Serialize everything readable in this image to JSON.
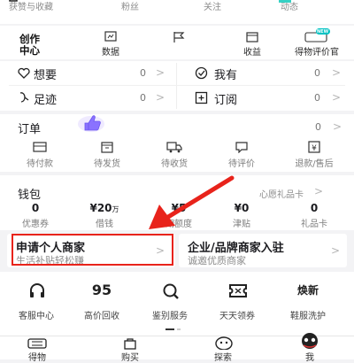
{
  "stats": [
    "获赞与收藏",
    "粉丝",
    "关注",
    "动态"
  ],
  "creation": {
    "title_line1": "创作",
    "title_line2": "中心",
    "items": [
      {
        "label": "数据",
        "icon": "chart-icon"
      },
      {
        "label": "",
        "icon": "flag-icon"
      },
      {
        "label": "收益",
        "icon": "wallet-icon"
      },
      {
        "label": "得物评价官",
        "icon": "new-badge-icon",
        "badge": "NEW"
      }
    ]
  },
  "quick_rows": [
    {
      "label": "想要",
      "count": "0",
      "icon": "heart-icon"
    },
    {
      "label": "我有",
      "count": "0",
      "icon": "check-circle-icon"
    },
    {
      "label": "足迹",
      "count": "0",
      "icon": "footprint-icon"
    },
    {
      "label": "订阅",
      "count": "0",
      "icon": "subscribe-icon"
    }
  ],
  "orders": {
    "title": "订单",
    "count": "0",
    "items": [
      {
        "label": "待付款",
        "icon": "card-icon"
      },
      {
        "label": "待发货",
        "icon": "box-icon"
      },
      {
        "label": "待收货",
        "icon": "truck-icon"
      },
      {
        "label": "待评价",
        "icon": "comment-icon"
      },
      {
        "label": "退款/售后",
        "icon": "refund-icon"
      }
    ]
  },
  "wallet": {
    "title": "钱包",
    "right_link": "心愿礼品卡",
    "items": [
      {
        "value": "0",
        "unit": "",
        "label": "优惠券"
      },
      {
        "value": "¥20",
        "unit": "万",
        "label": "借钱"
      },
      {
        "value": "¥5",
        "unit": "",
        "label": "期额度"
      },
      {
        "value": "¥0",
        "unit": "",
        "label": "津贴"
      },
      {
        "value": "0",
        "unit": "",
        "label": "礼品卡"
      }
    ]
  },
  "merchant": {
    "personal_title": "申请个人商家",
    "personal_sub": "生活补贴轻松赚",
    "enterprise_title": "企业/品牌商家入驻",
    "enterprise_sub": "诚邀优质商家"
  },
  "services": [
    {
      "label": "客服中心",
      "icon": "headset-icon"
    },
    {
      "label": "高价回收",
      "icon": "recycle-95-icon",
      "glyph": "95"
    },
    {
      "label": "鉴别服务",
      "icon": "magnifier-icon"
    },
    {
      "label": "天天领券",
      "icon": "ticket-icon"
    },
    {
      "label": "鞋服洗护",
      "icon": "wash-icon",
      "glyph": "焕新"
    }
  ],
  "tabbar": [
    {
      "label": "得物",
      "icon": "dewu-logo-icon"
    },
    {
      "label": "购买",
      "icon": "bag-icon"
    },
    {
      "label": "探索",
      "icon": "explore-icon"
    },
    {
      "label": "我",
      "icon": "avatar-icon"
    }
  ],
  "colors": {
    "annotation_red": "#e8231b",
    "accent_cyan": "#01c2c3",
    "thumbs_purple": "#8a72ff"
  }
}
